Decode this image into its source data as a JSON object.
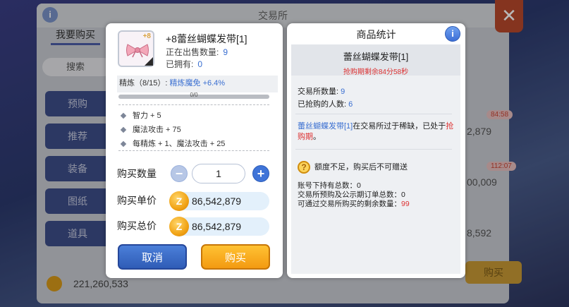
{
  "background": {
    "title": "交易所",
    "tab_my_buy": "我要购买",
    "search": "搜索",
    "side_items": [
      "预购",
      "推荐",
      "装备",
      "图纸",
      "道具"
    ],
    "coin_balance": "221,260,533",
    "right_timers": [
      "84:58",
      "112:07"
    ],
    "right_prices": [
      "2,879",
      "00,009",
      "8,592"
    ],
    "buy_label": "购买"
  },
  "purchase": {
    "item_name": "+8蕾丝蝴蝶发带[1]",
    "icon_level": "+8",
    "on_sale_label": "正在出售数量:",
    "on_sale_value": "9",
    "owned_label": "已拥有:",
    "owned_value": "0",
    "refine_label": "精炼（8/15）:",
    "refine_bonus": "精炼魔免 +6.4%",
    "progress_label": "0/0",
    "progress_fraction": 0,
    "stats": [
      "智力 + 5",
      "魔法攻击 + 75",
      "每精炼 + 1、魔法攻击 + 25"
    ],
    "quantity_label": "购买数量",
    "quantity_value": "1",
    "unit_price_label": "购买单价",
    "unit_price_value": "86,542,879",
    "total_price_label": "购买总价",
    "total_price_value": "86,542,879",
    "zeny_glyph": "Z",
    "cancel_label": "取消",
    "buy_label": "购买"
  },
  "stats_panel": {
    "title": "商品统计",
    "info_glyph": "i",
    "item_name": "蕾丝蝴蝶发带[1]",
    "timer": "抢购期剩余84分58秒",
    "exchange_count_label": "交易所数量:",
    "exchange_count_value": "9",
    "grabbed_label": "已抢购的人数:",
    "grabbed_value": "6",
    "scarcity_item": "蕾丝蝴蝶发带[1]",
    "scarcity_text": "在交易所过于稀缺，已处于",
    "scarcity_period": "抢购期",
    "scarcity_end": "。",
    "warning_text": "额度不足，购买后不可赠送",
    "account_total": "账号下持有总数：0",
    "preorder_total": "交易所预购及公示期订单总数：0",
    "remaining_label": "可通过交易所购买的剩余数量：",
    "remaining_value": "99"
  },
  "colors": {
    "accent_blue": "#3a6fd1",
    "warning_red": "#dd3333",
    "buy_orange": "#f39a11",
    "cancel_blue": "#2f5cb6"
  },
  "icons": {
    "item": "lace-bow-hairband-icon",
    "zeny": "zeny-coin-icon",
    "warning": "question-warning-icon",
    "close": "close-icon"
  }
}
